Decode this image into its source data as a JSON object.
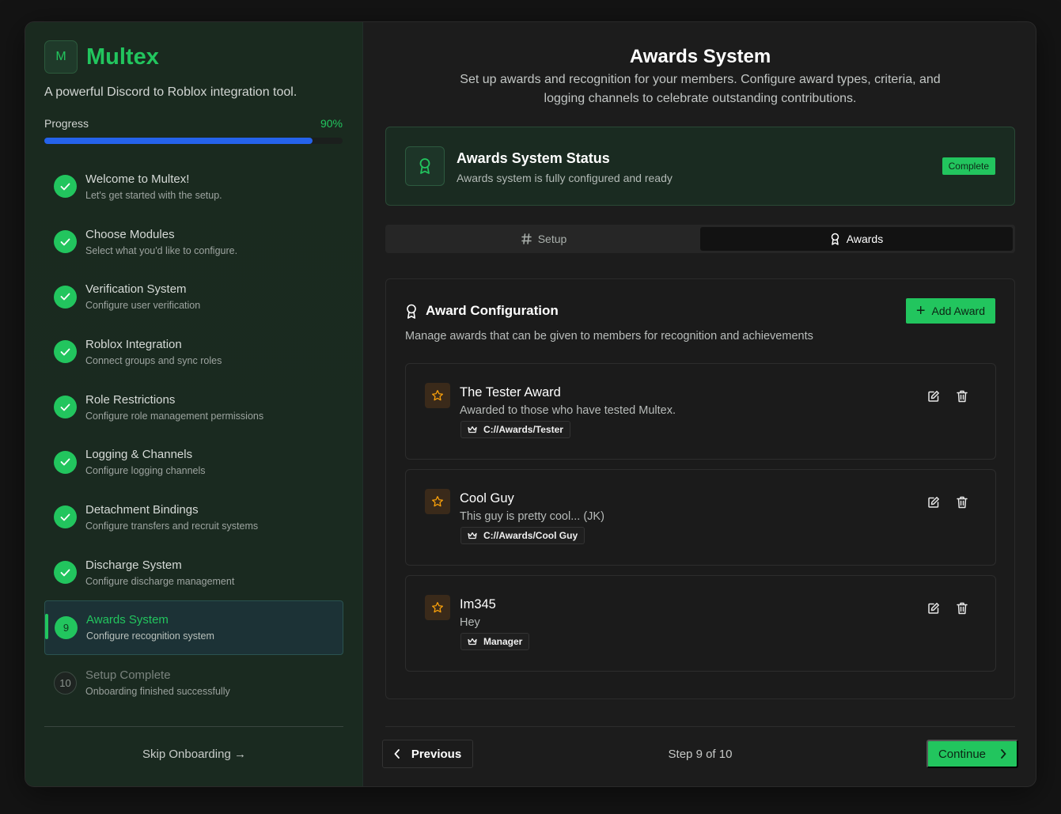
{
  "brand": {
    "logo_letter": "M",
    "name": "Multex",
    "tagline": "A powerful Discord to Roblox integration tool."
  },
  "progress": {
    "label": "Progress",
    "percent_text": "90%",
    "value": 0.9
  },
  "steps": [
    {
      "num": "1",
      "title": "Welcome to Multex!",
      "desc": "Let's get started with the setup.",
      "state": "done"
    },
    {
      "num": "2",
      "title": "Choose Modules",
      "desc": "Select what you'd like to configure.",
      "state": "done"
    },
    {
      "num": "3",
      "title": "Verification System",
      "desc": "Configure user verification",
      "state": "done"
    },
    {
      "num": "4",
      "title": "Roblox Integration",
      "desc": "Connect groups and sync roles",
      "state": "done"
    },
    {
      "num": "5",
      "title": "Role Restrictions",
      "desc": "Configure role management permissions",
      "state": "done"
    },
    {
      "num": "6",
      "title": "Logging & Channels",
      "desc": "Configure logging channels",
      "state": "done"
    },
    {
      "num": "7",
      "title": "Detachment Bindings",
      "desc": "Configure transfers and recruit systems",
      "state": "done"
    },
    {
      "num": "8",
      "title": "Discharge System",
      "desc": "Configure discharge management",
      "state": "done"
    },
    {
      "num": "9",
      "title": "Awards System",
      "desc": "Configure recognition system",
      "state": "active"
    },
    {
      "num": "10",
      "title": "Setup Complete",
      "desc": "Onboarding finished successfully",
      "state": "pending"
    }
  ],
  "skip_label": "Skip Onboarding →",
  "header": {
    "title": "Awards System",
    "subtitle": "Set up awards and recognition for your members. Configure award types, criteria, and logging channels to celebrate outstanding contributions."
  },
  "status": {
    "title": "Awards System Status",
    "desc": "Awards system is fully configured and ready",
    "badge": "Complete"
  },
  "tabs": [
    {
      "label": "Setup",
      "icon": "hash-icon",
      "active": false
    },
    {
      "label": "Awards",
      "icon": "award-icon",
      "active": true
    }
  ],
  "config": {
    "title": "Award Configuration",
    "desc": "Manage awards that can be given to members for recognition and achievements",
    "add_label": "Add Award"
  },
  "awards": [
    {
      "name": "The Tester Award",
      "desc": "Awarded to those who have tested Multex.",
      "role": "C://Awards/Tester"
    },
    {
      "name": "Cool Guy",
      "desc": "This guy is pretty cool... (JK)",
      "role": "C://Awards/Cool Guy"
    },
    {
      "name": "Im345",
      "desc": "Hey",
      "role": "Manager"
    }
  ],
  "footer": {
    "prev_label": "Previous",
    "step_text": "Step 9 of 10",
    "continue_label": "Continue"
  },
  "colors": {
    "accent": "#22c55e",
    "progress": "#2563eb",
    "star": "#f59e0b"
  }
}
